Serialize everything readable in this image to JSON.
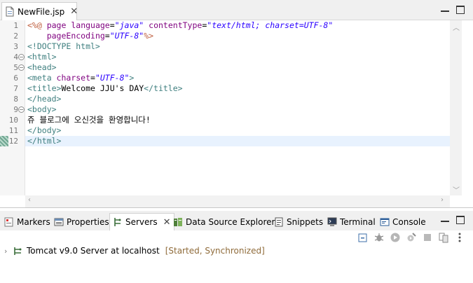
{
  "editor": {
    "tab_label": "NewFile.jsp",
    "tab_close_icon": "close-icon",
    "minimize_icon": "minimize-icon",
    "maximize_icon": "maximize-icon",
    "lines": [
      {
        "num": "1",
        "parts": [
          {
            "t": "jsp",
            "s": "<%@ "
          },
          {
            "t": "attr",
            "s": "page"
          },
          {
            "t": "plain",
            "s": " "
          },
          {
            "t": "attr",
            "s": "language"
          },
          {
            "t": "plain",
            "s": "="
          },
          {
            "t": "val",
            "s": "\"java\""
          },
          {
            "t": "plain",
            "s": " "
          },
          {
            "t": "attr",
            "s": "contentType"
          },
          {
            "t": "plain",
            "s": "="
          },
          {
            "t": "val",
            "s": "\"text/html; charset=UTF-8\""
          }
        ]
      },
      {
        "num": "2",
        "parts": [
          {
            "t": "plain",
            "s": "    "
          },
          {
            "t": "attr",
            "s": "pageEncoding"
          },
          {
            "t": "plain",
            "s": "="
          },
          {
            "t": "val",
            "s": "\"UTF-8\""
          },
          {
            "t": "jsp",
            "s": "%>"
          }
        ]
      },
      {
        "num": "3",
        "parts": [
          {
            "t": "tag",
            "s": "<!DOCTYPE html>"
          }
        ]
      },
      {
        "num": "4",
        "fold": true,
        "parts": [
          {
            "t": "tag",
            "s": "<html>"
          }
        ]
      },
      {
        "num": "5",
        "fold": true,
        "parts": [
          {
            "t": "tag",
            "s": "<head>"
          }
        ]
      },
      {
        "num": "6",
        "parts": [
          {
            "t": "tag",
            "s": "<meta "
          },
          {
            "t": "attr",
            "s": "charset"
          },
          {
            "t": "plain",
            "s": "="
          },
          {
            "t": "val",
            "s": "\"UTF-8\""
          },
          {
            "t": "tag",
            "s": ">"
          }
        ]
      },
      {
        "num": "7",
        "parts": [
          {
            "t": "tag",
            "s": "<title>"
          },
          {
            "t": "plain",
            "s": "Welcome JJU's DAY"
          },
          {
            "t": "tag",
            "s": "</title>"
          }
        ]
      },
      {
        "num": "8",
        "parts": [
          {
            "t": "tag",
            "s": "</head>"
          }
        ]
      },
      {
        "num": "9",
        "fold": true,
        "parts": [
          {
            "t": "tag",
            "s": "<body>"
          }
        ]
      },
      {
        "num": "10",
        "parts": [
          {
            "t": "plain",
            "s": "쥬 블로그에 오신것을 환영합니다!"
          }
        ]
      },
      {
        "num": "11",
        "parts": [
          {
            "t": "tag",
            "s": "</body>"
          }
        ]
      },
      {
        "num": "12",
        "current": true,
        "parts": [
          {
            "t": "tag",
            "s": "</html>"
          }
        ]
      }
    ]
  },
  "views": {
    "tabs": [
      {
        "label": "Markers",
        "icon": "markers-icon"
      },
      {
        "label": "Properties",
        "icon": "properties-icon"
      },
      {
        "label": "Servers",
        "icon": "servers-icon",
        "active": true
      },
      {
        "label": "Data Source Explorer",
        "icon": "data-source-explorer-icon"
      },
      {
        "label": "Snippets",
        "icon": "snippets-icon"
      },
      {
        "label": "Terminal",
        "icon": "terminal-icon"
      },
      {
        "label": "Console",
        "icon": "console-icon"
      }
    ],
    "toolbar": [
      "collapse-all-icon",
      "debug-server-icon",
      "start-server-icon",
      "profile-server-icon",
      "stop-server-icon",
      "publish-icon",
      "view-menu-icon"
    ],
    "servers": {
      "name": "Tomcat v9.0 Server at localhost",
      "status": "[Started, Synchronized]"
    }
  },
  "colors": {
    "tag": "#3f7f7f",
    "attribute": "#7f007f",
    "string": "#2a00ff",
    "jsp_delimiter": "#bf5f3f",
    "current_line": "#e8f2fe"
  }
}
